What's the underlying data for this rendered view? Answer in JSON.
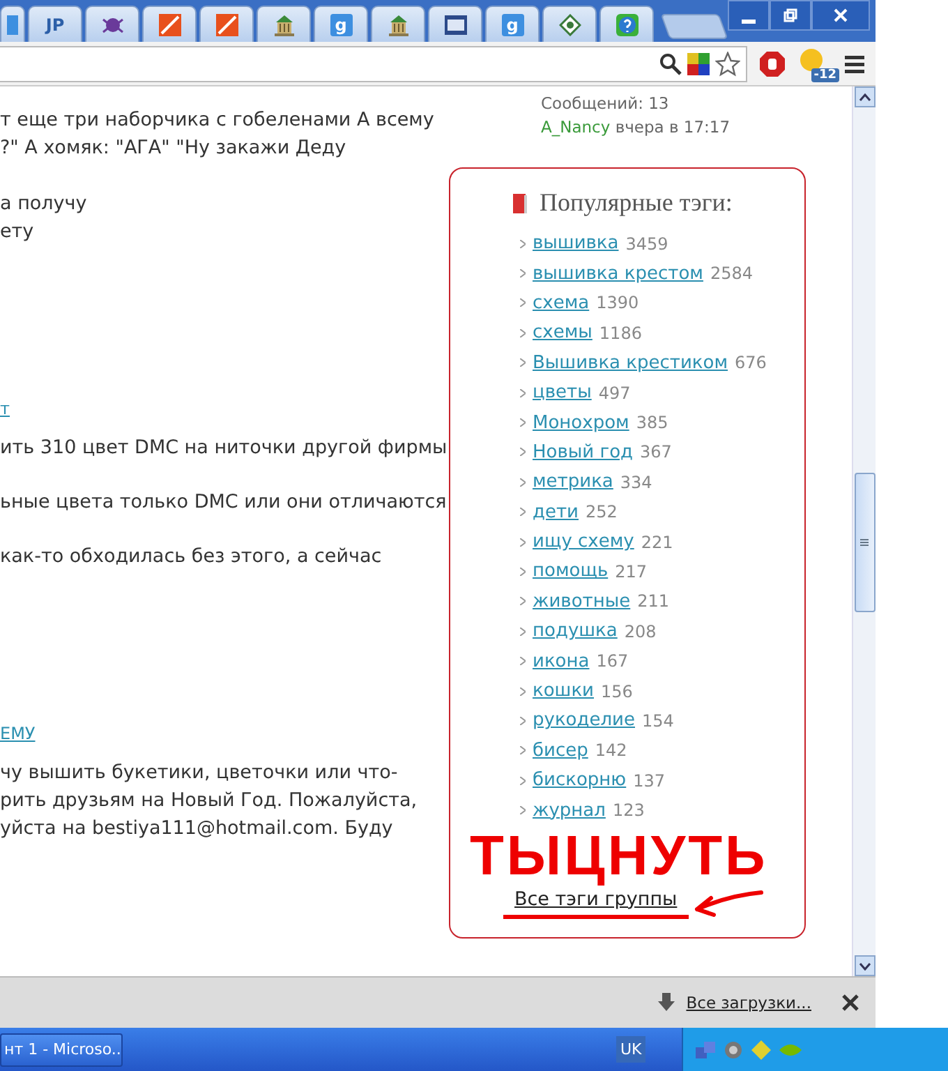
{
  "tabs": [
    {
      "kind": "partial"
    },
    {
      "kind": "text",
      "glyph": "JP"
    },
    {
      "kind": "puzzle"
    },
    {
      "kind": "orange"
    },
    {
      "kind": "orange"
    },
    {
      "kind": "building"
    },
    {
      "kind": "text-blue",
      "glyph": "g"
    },
    {
      "kind": "building"
    },
    {
      "kind": "news"
    },
    {
      "kind": "text-blue",
      "glyph": "g"
    },
    {
      "kind": "diamond"
    },
    {
      "kind": "help"
    }
  ],
  "toolbar": {
    "weather_badge": "-12"
  },
  "post_meta": {
    "label": "Сообщений: 13",
    "author": "A_Nancy",
    "time": "вчера в 17:17"
  },
  "post_lines": [
    {
      "kind": "text",
      "text": "т еще три наборчика с гобеленами А всему"
    },
    {
      "kind": "text",
      "text": "?\" А хомяк: \"АГА\" \"Ну закажи Деду"
    },
    {
      "kind": "text",
      "text": "а получу"
    },
    {
      "kind": "text",
      "text": "ету"
    },
    {
      "kind": "link",
      "text": "т"
    },
    {
      "kind": "text",
      "text": "ить 310 цвет DMC на ниточки другой фирмы"
    },
    {
      "kind": "text",
      "text": "ьные цвета только DMC или они отличаются"
    },
    {
      "kind": "text",
      "text": "как-то обходилась без этого, а сейчас"
    },
    {
      "kind": "link",
      "text": "ЕМУ"
    },
    {
      "kind": "text",
      "text": "чу вышить букетики, цветочки или что-"
    },
    {
      "kind": "text",
      "text": "рить друзьям на Новый Год. Пожалуйста,"
    },
    {
      "kind": "text",
      "text": "уйста на bestiya111@hotmail.com. Буду"
    }
  ],
  "tags_panel": {
    "title": "Популярные тэги:",
    "tags": [
      {
        "name": "вышивка",
        "count": "3459"
      },
      {
        "name": "вышивка крестом",
        "count": "2584"
      },
      {
        "name": "схема",
        "count": "1390"
      },
      {
        "name": "схемы",
        "count": "1186"
      },
      {
        "name": "Вышивка крестиком",
        "count": "676"
      },
      {
        "name": "цветы",
        "count": "497"
      },
      {
        "name": "Монохром",
        "count": "385"
      },
      {
        "name": "Новый год",
        "count": "367"
      },
      {
        "name": "метрика",
        "count": "334"
      },
      {
        "name": "дети",
        "count": "252"
      },
      {
        "name": "ищу схему",
        "count": "221"
      },
      {
        "name": "помощь",
        "count": "217"
      },
      {
        "name": "животные",
        "count": "211"
      },
      {
        "name": "подушка",
        "count": "208"
      },
      {
        "name": "икона",
        "count": "167"
      },
      {
        "name": "кошки",
        "count": "156"
      },
      {
        "name": "рукоделие",
        "count": "154"
      },
      {
        "name": "бисер",
        "count": "142"
      },
      {
        "name": "бискорню",
        "count": "137"
      },
      {
        "name": "журнал",
        "count": "123"
      }
    ],
    "annotation": "ТЫЦНУТЬ",
    "all_tags_link": "Все тэги группы"
  },
  "downloads_bar": {
    "link": "Все загрузки..."
  },
  "taskbar": {
    "task": "нт 1 - Microso...",
    "language": "UK"
  }
}
